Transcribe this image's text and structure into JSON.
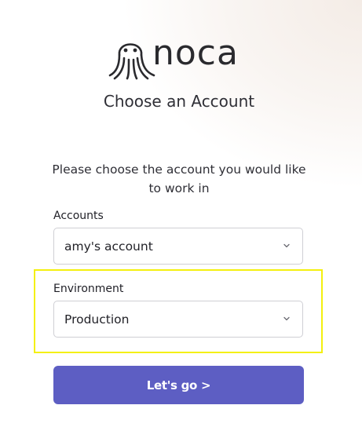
{
  "brand": {
    "name": "noca",
    "logo_icon": "octopus-icon"
  },
  "title": "Choose an Account",
  "instruction": "Please choose the account you would like to work in",
  "accounts": {
    "label": "Accounts",
    "selected": "amy's account"
  },
  "environment": {
    "label": "Environment",
    "selected": "Production"
  },
  "submit": {
    "label": "Let's go >"
  },
  "colors": {
    "button": "#5d5ec3",
    "highlight": "#f4f00f"
  }
}
